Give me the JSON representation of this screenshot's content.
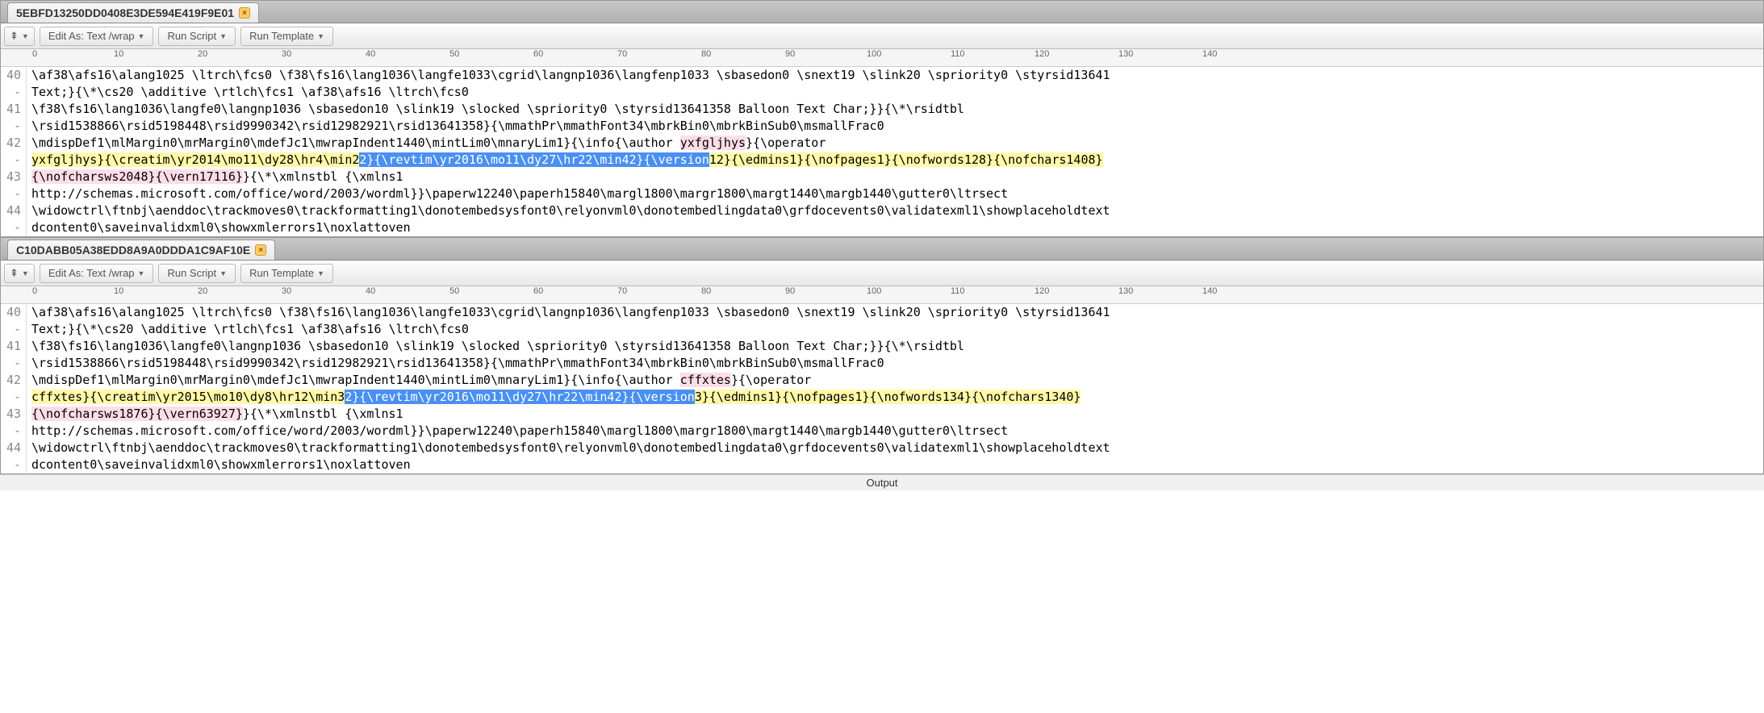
{
  "pane1": {
    "tab_title": "5EBFD13250DD0408E3DE594E419F9E01",
    "toolbar": {
      "expand": "⇞",
      "edit_as": "Edit As: Text /wrap",
      "run_script": "Run Script",
      "run_template": "Run Template"
    },
    "ruler": [
      "0",
      "10",
      "20",
      "30",
      "40",
      "50",
      "60",
      "70",
      "80",
      "90",
      "100",
      "110",
      "120",
      "130",
      "140"
    ],
    "gutter": [
      "40",
      "-",
      "41",
      "-",
      "42",
      "-",
      "43",
      "-",
      "44",
      "-"
    ],
    "lines": [
      [
        {
          "t": "\\af38\\afs16\\alang1025 \\ltrch\\fcs0 \\f38\\fs16\\lang1036\\langfe1033\\cgrid\\langnp1036\\langfenp1033 \\sbasedon0 \\snext19 \\slink20 \\spriority0 \\styrsid13641"
        }
      ],
      [
        {
          "t": "Text;}{\\*\\cs20 \\additive \\rtlch\\fcs1 \\af38\\afs16 \\ltrch\\fcs0"
        }
      ],
      [
        {
          "t": "\\f38\\fs16\\lang1036\\langfe0\\langnp1036 \\sbasedon10 \\slink19 \\slocked \\spriority0 \\styrsid13641358 Balloon Text Char;}}{\\*\\rsidtbl"
        }
      ],
      [
        {
          "t": "\\rsid1538866\\rsid5198448\\rsid9990342\\rsid12982921\\rsid13641358}{\\mmathPr\\mmathFont34\\mbrkBin0\\mbrkBinSub0\\msmallFrac0"
        }
      ],
      [
        {
          "t": "\\mdispDef1\\mlMargin0\\mrMargin0\\mdefJc1\\mwrapIndent1440\\mintLim0\\mnaryLim1}{\\info{\\author "
        },
        {
          "t": "yxfgljhys",
          "c": "hl-pink"
        },
        {
          "t": "}{\\operator"
        }
      ],
      [
        {
          "t": "yxfgljhys}{\\creatim\\yr2014\\mo11\\dy28\\hr4\\min2",
          "c": "hl-yellow"
        },
        {
          "t": "2}{\\revtim\\yr2016\\mo11\\dy27\\hr22\\min42}{\\version",
          "c": "hl-blue"
        },
        {
          "t": "12}{\\edmins1}{\\nofpages1}{\\nofwords128}{\\nofchars1408}",
          "c": "hl-yellow"
        }
      ],
      [
        {
          "t": "{\\nofcharsws2048}{\\vern17116}",
          "c": "hl-pink"
        },
        {
          "t": "}{\\*\\xmlnstbl {\\xmlns1"
        }
      ],
      [
        {
          "t": "http://schemas.microsoft.com/office/word/2003/wordml}}\\paperw12240\\paperh15840\\margl1800\\margr1800\\margt1440\\margb1440\\gutter0\\ltrsect"
        }
      ],
      [
        {
          "t": "\\widowctrl\\ftnbj\\aenddoc\\trackmoves0\\trackformatting1\\donotembedsysfont0\\relyonvml0\\donotembedlingdata0\\grfdocevents0\\validatexml1\\showplaceholdtext"
        }
      ],
      [
        {
          "t": "dcontent0\\saveinvalidxml0\\showxmlerrors1\\noxlattoven"
        }
      ]
    ]
  },
  "pane2": {
    "tab_title": "C10DABB05A38EDD8A9A0DDDA1C9AF10E",
    "toolbar": {
      "expand": "⇞",
      "edit_as": "Edit As: Text /wrap",
      "run_script": "Run Script",
      "run_template": "Run Template"
    },
    "ruler": [
      "0",
      "10",
      "20",
      "30",
      "40",
      "50",
      "60",
      "70",
      "80",
      "90",
      "100",
      "110",
      "120",
      "130",
      "140"
    ],
    "gutter": [
      "40",
      "-",
      "41",
      "-",
      "42",
      "-",
      "43",
      "-",
      "44",
      "-"
    ],
    "lines": [
      [
        {
          "t": "\\af38\\afs16\\alang1025 \\ltrch\\fcs0 \\f38\\fs16\\lang1036\\langfe1033\\cgrid\\langnp1036\\langfenp1033 \\sbasedon0 \\snext19 \\slink20 \\spriority0 \\styrsid13641"
        }
      ],
      [
        {
          "t": "Text;}{\\*\\cs20 \\additive \\rtlch\\fcs1 \\af38\\afs16 \\ltrch\\fcs0"
        }
      ],
      [
        {
          "t": "\\f38\\fs16\\lang1036\\langfe0\\langnp1036 \\sbasedon10 \\slink19 \\slocked \\spriority0 \\styrsid13641358 Balloon Text Char;}}{\\*\\rsidtbl"
        }
      ],
      [
        {
          "t": "\\rsid1538866\\rsid5198448\\rsid9990342\\rsid12982921\\rsid13641358}{\\mmathPr\\mmathFont34\\mbrkBin0\\mbrkBinSub0\\msmallFrac0"
        }
      ],
      [
        {
          "t": "\\mdispDef1\\mlMargin0\\mrMargin0\\mdefJc1\\mwrapIndent1440\\mintLim0\\mnaryLim1}{\\info{\\author "
        },
        {
          "t": "cffxtes",
          "c": "hl-pink"
        },
        {
          "t": "}{\\operator"
        }
      ],
      [
        {
          "t": "cffxtes}{\\creatim\\yr2015\\mo10\\dy8\\hr12\\min3",
          "c": "hl-yellow"
        },
        {
          "t": "2}{\\revtim\\yr2016\\mo11\\dy27\\hr22\\min42}{\\version",
          "c": "hl-blue"
        },
        {
          "t": "3}{\\edmins1}{\\nofpages1}{\\nofwords134}{\\nofchars1340}",
          "c": "hl-yellow"
        }
      ],
      [
        {
          "t": "{\\nofcharsws1876}{\\vern63927}",
          "c": "hl-pink"
        },
        {
          "t": "}{\\*\\xmlnstbl {\\xmlns1"
        }
      ],
      [
        {
          "t": "http://schemas.microsoft.com/office/word/2003/wordml}}\\paperw12240\\paperh15840\\margl1800\\margr1800\\margt1440\\margb1440\\gutter0\\ltrsect"
        }
      ],
      [
        {
          "t": "\\widowctrl\\ftnbj\\aenddoc\\trackmoves0\\trackformatting1\\donotembedsysfont0\\relyonvml0\\donotembedlingdata0\\grfdocevents0\\validatexml1\\showplaceholdtext"
        }
      ],
      [
        {
          "t": "dcontent0\\saveinvalidxml0\\showxmlerrors1\\noxlattoven"
        }
      ]
    ]
  },
  "output_label": "Output"
}
